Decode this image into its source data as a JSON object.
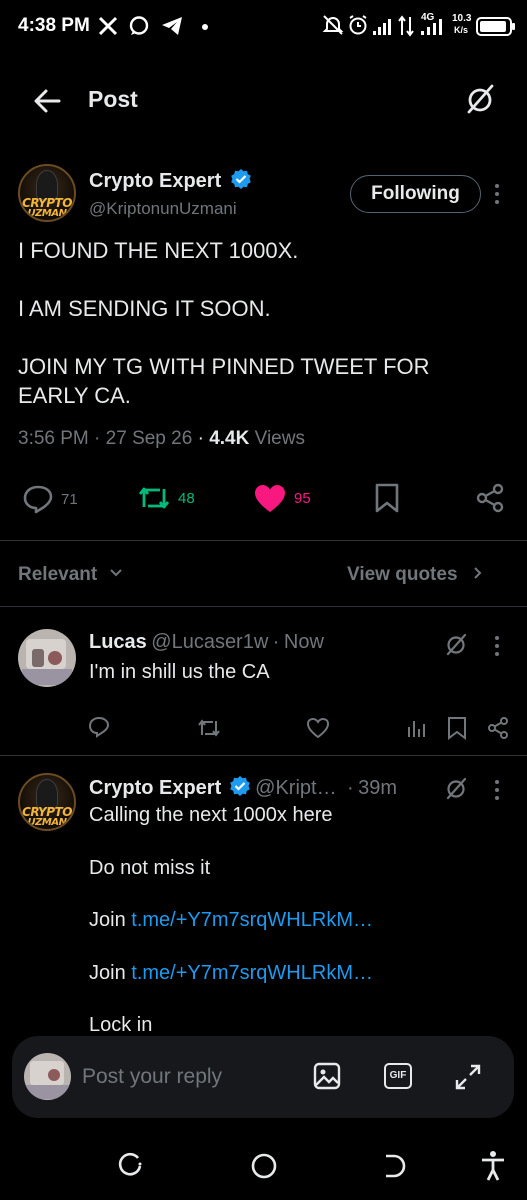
{
  "status_bar": {
    "time": "4:38 PM",
    "network_badge": "4G",
    "speed_value": "10.3",
    "speed_unit": "K/s",
    "icons": [
      "x-logo-icon",
      "messenger-icon",
      "telegram-icon",
      "dot-icon",
      "mute-icon",
      "alarm-icon",
      "signal-icon",
      "data-arrows-icon",
      "signal-icon",
      "battery-icon"
    ]
  },
  "header": {
    "title": "Post",
    "back_icon": "arrow-left-icon",
    "grok_icon": "grok-icon"
  },
  "post": {
    "author_name": "Crypto Expert",
    "author_handle": "@KriptonunUzmani",
    "avatar_text_line1": "CRYPTO",
    "avatar_text_line2": "UZMAN",
    "follow_label": "Following",
    "lines": [
      "I FOUND THE NEXT 1000X.",
      "I AM SENDING IT SOON.",
      "JOIN MY TG WITH PINNED TWEET FOR",
      "EARLY CA."
    ],
    "time": "3:56 PM",
    "sep": "·",
    "date": "27 Sep 26",
    "views_count": "4.4K",
    "views_label": "Views",
    "replies": "71",
    "reposts": "48",
    "likes": "95",
    "colors": {
      "repost": "#00ba7c",
      "like": "#f91880",
      "link": "#1d9bf0"
    }
  },
  "filters": {
    "sort_label": "Relevant",
    "quotes_label": "View quotes"
  },
  "replies": [
    {
      "name": "Lucas",
      "handle": "@Lucaser1w",
      "sep": "·",
      "time": "Now",
      "text": "I'm in shill us the CA"
    },
    {
      "name": "Crypto Expert",
      "handle": "@Kript…",
      "sep": "·",
      "time": "39m",
      "line1": "Calling the next 1000x here",
      "line2": "Do not miss it",
      "join_label": "Join",
      "link1": "t.me/+Y7m7srqWHLRkM…",
      "link2": "t.me/+Y7m7srqWHLRkM…",
      "line5": "Lock in"
    }
  ],
  "composer": {
    "placeholder": "Post your reply",
    "gif_label": "GIF"
  }
}
